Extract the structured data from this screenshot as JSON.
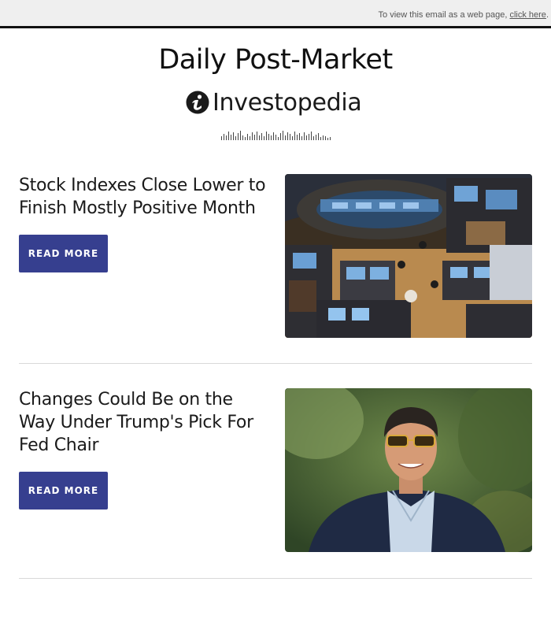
{
  "topbar": {
    "text": "To view this email as a web page,",
    "link": "click here",
    "trailing": "."
  },
  "header": {
    "title": "Daily Post-Market",
    "brand": "Investopedia"
  },
  "articles": [
    {
      "headline": "Stock Indexes Close Lower to Finish Mostly Positive Month",
      "button_label": "READ MORE",
      "image": "trading-floor-photo"
    },
    {
      "headline": "Changes Could Be on the Way Under Trump's Pick For Fed Chair",
      "button_label": "READ MORE",
      "image": "man-in-sunglasses-photo"
    }
  ],
  "colors": {
    "button_bg": "#363f8f",
    "topbar_bg": "#efefef",
    "divider": "#d9d9d9"
  }
}
